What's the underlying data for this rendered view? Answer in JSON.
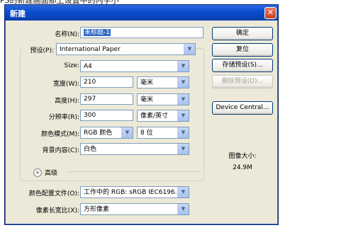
{
  "top_caption": "PS的新建画面那上设置中的内字小",
  "window": {
    "title": "新建",
    "close_glyph": "✕"
  },
  "form": {
    "name_label": "名称(N):",
    "name_value": "未标题-1",
    "preset_label": "预设(P):",
    "preset_value": "International Paper",
    "size_label": "Size:",
    "size_value": "A4",
    "width_label": "宽度(W):",
    "width_value": "210",
    "width_unit": "毫米",
    "height_label": "高度(H):",
    "height_value": "297",
    "height_unit": "毫米",
    "resolution_label": "分辨率(R):",
    "resolution_value": "300",
    "resolution_unit": "像素/英寸",
    "color_mode_label": "颜色模式(M):",
    "color_mode_value": "RGB 颜色",
    "bit_depth_value": "8 位",
    "background_label": "背景内容(C):",
    "background_value": "白色",
    "advanced_label": "高级",
    "advanced_icon": "«",
    "color_profile_label": "颜色配置文件(O):",
    "color_profile_value": "工作中的 RGB: sRGB IEC6196...",
    "pixel_aspect_label": "像素长宽比(X):",
    "pixel_aspect_value": "方形像素"
  },
  "buttons": {
    "ok": "确定",
    "reset": "复位",
    "save_preset": "存储预设(S)...",
    "delete_preset": "删除预设(D)...",
    "device_central": "Device Central..."
  },
  "image_size": {
    "label": "图像大小:",
    "value": "24.9M"
  },
  "dropdown_glyph": "▼"
}
